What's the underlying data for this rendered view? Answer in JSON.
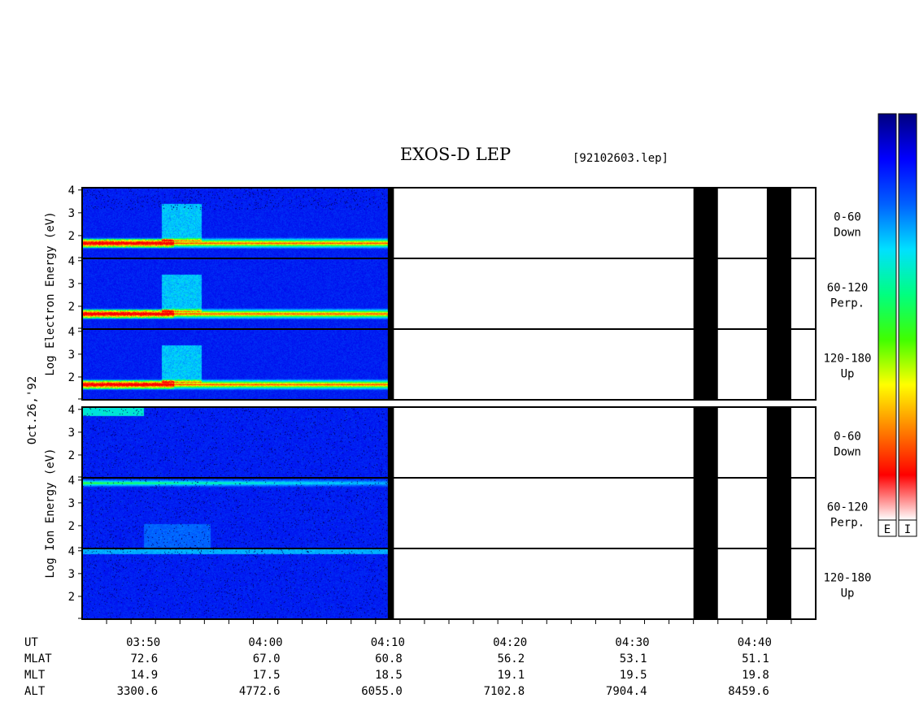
{
  "header": {
    "title": "EXOS-D LEP",
    "file_label": "[92102603.lep]",
    "date_label": "Oct.26,'92"
  },
  "chart_data": {
    "type": "heatmap",
    "title": "EXOS-D LEP",
    "time_axis": {
      "start": "03:45",
      "end": "04:45",
      "major_tick_labels": [
        "03:50",
        "04:00",
        "04:10",
        "04:20",
        "04:30",
        "04:40"
      ],
      "minor_tick_interval_minutes": 2
    },
    "data_end_time": "04:10",
    "data_gaps": [
      {
        "start": "04:10",
        "end": "04:10.5"
      },
      {
        "start": "04:35",
        "end": "04:37"
      },
      {
        "start": "04:41",
        "end": "04:43"
      }
    ],
    "panels": [
      {
        "ylabel": "Log  Electron  Energy (eV)",
        "species": "electron",
        "ylim": [
          1,
          4.1
        ],
        "yticks": [
          "4",
          "3",
          "2"
        ],
        "subpanels": [
          {
            "label_line1": "0-60",
            "label_line2": "Down"
          },
          {
            "label_line1": "60-120",
            "label_line2": "Perp."
          },
          {
            "label_line1": "120-180",
            "label_line2": "Up"
          }
        ]
      },
      {
        "ylabel": "Log  Ion  Energy (eV)",
        "species": "ion",
        "ylim": [
          1,
          4.1
        ],
        "yticks": [
          "4",
          "3",
          "2"
        ],
        "subpanels": [
          {
            "label_line1": "0-60",
            "label_line2": "Down"
          },
          {
            "label_line1": "60-120",
            "label_line2": "Perp."
          },
          {
            "label_line1": "120-180",
            "label_line2": "Up"
          }
        ]
      }
    ],
    "colorbars": [
      {
        "label": "E",
        "colors": [
          "#00007f",
          "#0000ff",
          "#0060ff",
          "#00e0ff",
          "#00ff80",
          "#40ff00",
          "#ffff00",
          "#ff8000",
          "#ff0000",
          "#ffffff"
        ]
      },
      {
        "label": "I",
        "colors": [
          "#00007f",
          "#0000ff",
          "#0060ff",
          "#00e0ff",
          "#00ff80",
          "#40ff00",
          "#ffff00",
          "#ff8000",
          "#ff0000",
          "#ffffff"
        ]
      }
    ],
    "orbit_table": {
      "times": [
        "03:50",
        "04:00",
        "04:10",
        "04:20",
        "04:30",
        "04:40"
      ],
      "rows": [
        {
          "label": "UT",
          "values": []
        },
        {
          "label": "MLAT",
          "values": [
            "72.6",
            "67.0",
            "60.8",
            "56.2",
            "53.1",
            "51.1"
          ]
        },
        {
          "label": "MLT",
          "values": [
            "14.9",
            "17.5",
            "18.5",
            "19.1",
            "19.5",
            "19.8"
          ]
        },
        {
          "label": "ALT",
          "values": [
            "3300.6",
            "4772.6",
            "6055.0",
            "7102.8",
            "7904.4",
            "8459.6"
          ]
        }
      ]
    }
  }
}
